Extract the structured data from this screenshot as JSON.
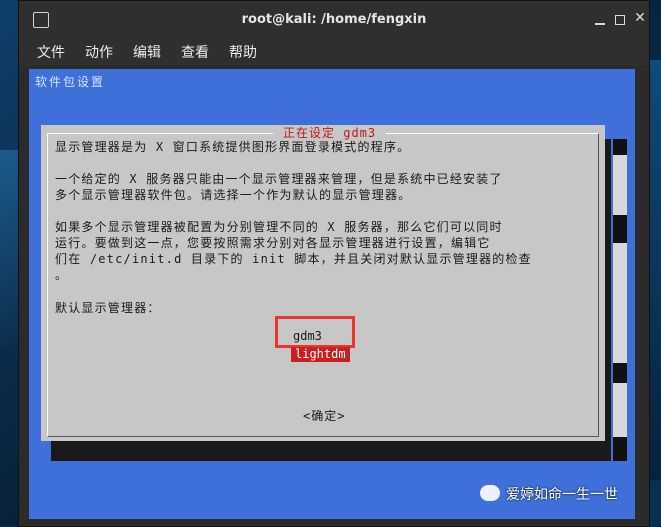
{
  "window": {
    "title": "root@kali: /home/fengxin"
  },
  "menubar": {
    "items": [
      "文件",
      "动作",
      "编辑",
      "查看",
      "帮助"
    ]
  },
  "terminal": {
    "backtitle": "软件包设置",
    "dialog": {
      "title": "正在设定 gdm3",
      "paragraph1": "显示管理器是为 X 窗口系统提供图形界面登录模式的程序。",
      "paragraph2_line1": "一个给定的 X 服务器只能由一个显示管理器来管理，但是系统中已经安装了",
      "paragraph2_line2": "多个显示管理器软件包。请选择一个作为默认的显示管理器。",
      "paragraph3_line1": "如果多个显示管理器被配置为分别管理不同的 X 服务器，那么它们可以同时",
      "paragraph3_line2": "运行。要做到这一点，您要按照需求分别对各显示管理器进行设置，编辑它",
      "paragraph3_line3": "们在 /etc/init.d 目录下的 init 脚本，并且关闭对默认显示管理器的检查",
      "paragraph3_line4": "。",
      "prompt": "默认显示管理器：",
      "options": [
        {
          "label": "gdm3",
          "selected": false
        },
        {
          "label": "lightdm",
          "selected": true
        }
      ],
      "ok_label": "<确定>"
    }
  },
  "watermark": {
    "text": "爱婷如命一生一世",
    "icon": "wechat-icon"
  },
  "colors": {
    "terminal_bg": "#3f6fd8",
    "dialog_bg": "#c7c7c7",
    "selection": "#c62020",
    "title": "#c01818"
  }
}
